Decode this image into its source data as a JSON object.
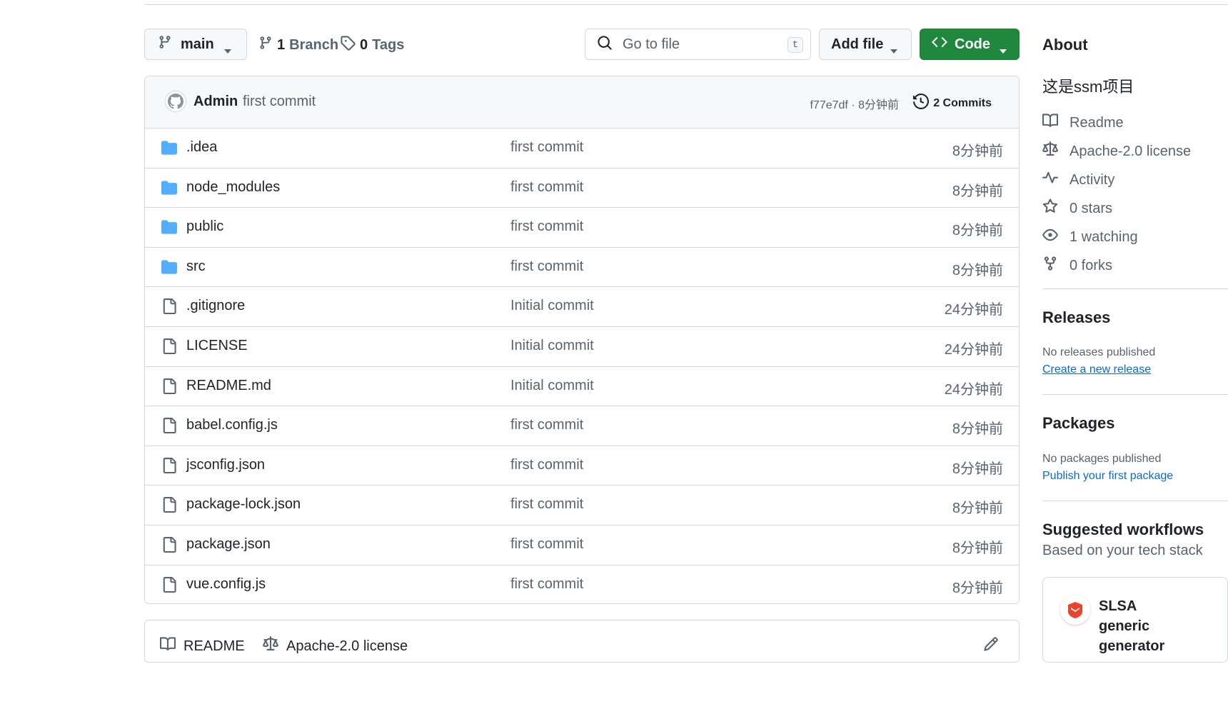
{
  "toolbar": {
    "branch": "main",
    "branch_count": "1",
    "branch_label": "Branch",
    "tag_count": "0",
    "tag_label": "Tags",
    "search_placeholder": "Go to file",
    "search_shortcut": "t",
    "add_file": "Add file",
    "code": "Code"
  },
  "latest_commit": {
    "author": "Admin",
    "message": "first commit",
    "sha_time": "f77e7df · 8分钟前",
    "commits_count": "2 Commits"
  },
  "files": [
    {
      "name": ".idea",
      "type": "folder",
      "message": "first commit",
      "time": "8分钟前"
    },
    {
      "name": "node_modules",
      "type": "folder",
      "message": "first commit",
      "time": "8分钟前"
    },
    {
      "name": "public",
      "type": "folder",
      "message": "first commit",
      "time": "8分钟前"
    },
    {
      "name": "src",
      "type": "folder",
      "message": "first commit",
      "time": "8分钟前"
    },
    {
      "name": ".gitignore",
      "type": "file",
      "message": "Initial commit",
      "time": "24分钟前"
    },
    {
      "name": "LICENSE",
      "type": "file",
      "message": "Initial commit",
      "time": "24分钟前"
    },
    {
      "name": "README.md",
      "type": "file",
      "message": "Initial commit",
      "time": "24分钟前"
    },
    {
      "name": "babel.config.js",
      "type": "file",
      "message": "first commit",
      "time": "8分钟前"
    },
    {
      "name": "jsconfig.json",
      "type": "file",
      "message": "first commit",
      "time": "8分钟前"
    },
    {
      "name": "package-lock.json",
      "type": "file",
      "message": "first commit",
      "time": "8分钟前"
    },
    {
      "name": "package.json",
      "type": "file",
      "message": "first commit",
      "time": "8分钟前"
    },
    {
      "name": "vue.config.js",
      "type": "file",
      "message": "first commit",
      "time": "8分钟前"
    }
  ],
  "readme_tabs": {
    "readme": "README",
    "license": "Apache-2.0 license"
  },
  "sidebar": {
    "about_title": "About",
    "description": "这是ssm项目",
    "items": {
      "readme": "Readme",
      "license": "Apache-2.0 license",
      "activity": "Activity",
      "stars": "0 stars",
      "watching": "1 watching",
      "forks": "0 forks"
    },
    "releases_title": "Releases",
    "releases_text": "No releases published",
    "releases_link": "Create a new release",
    "packages_title": "Packages",
    "packages_text": "No packages published",
    "packages_link": "Publish your first package",
    "suggested_title": "Suggested workflows",
    "suggested_sub": "Based on your tech stack",
    "suggest_card_title": "SLSA generic generator"
  },
  "colors": {
    "accent_green": "#1f883d",
    "link_blue": "#0969da",
    "folder_blue": "#54aeff",
    "muted_text": "#59636e",
    "border": "#d1d9e0"
  },
  "icons": {
    "branch": "git-branch-icon",
    "tag": "tag-icon",
    "search": "search-icon",
    "code": "code-icon",
    "history": "history-icon",
    "folder": "folder-icon",
    "file": "file-icon",
    "book": "book-icon",
    "law": "law-icon",
    "pulse": "pulse-icon",
    "star": "star-icon",
    "eye": "eye-icon",
    "fork": "repo-forked-icon"
  }
}
